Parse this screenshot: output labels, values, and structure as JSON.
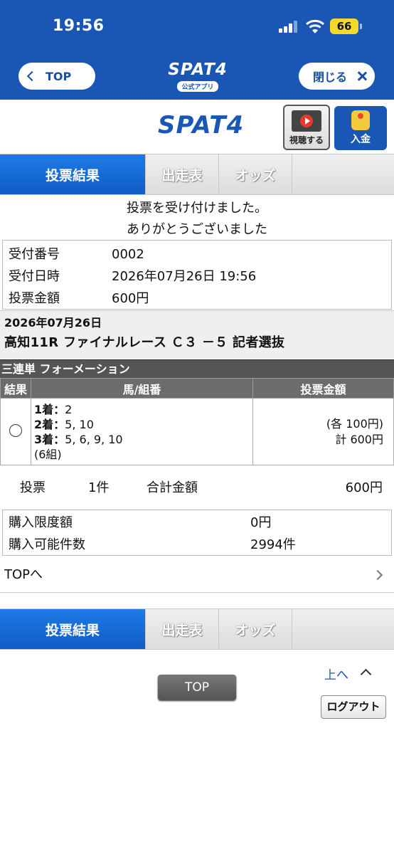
{
  "status_bar": {
    "time": "19:56",
    "battery": "66"
  },
  "app_bar": {
    "back_label": "TOP",
    "logo_text": "SPAT4",
    "logo_sub": "公式アプリ",
    "close_label": "閉じる"
  },
  "header": {
    "logo_text": "SPAT4",
    "watch_label": "視聴する",
    "deposit_label": "入金"
  },
  "tabs": [
    "投票結果",
    "出走表",
    "オッズ",
    ""
  ],
  "confirmation": {
    "line1": "投票を受け付けました。",
    "line2": "ありがとうございました"
  },
  "receipt": {
    "number_label": "受付番号",
    "number_value": "0002",
    "datetime_label": "受付日時",
    "datetime_value": "2026年07月26日 19:56",
    "amount_label": "投票金額",
    "amount_value": "600円"
  },
  "race": {
    "date": "2026年07月26日",
    "name": "高知11R ファイナルレース Ｃ３ －５ 記者選抜"
  },
  "bet_type": "三連単 フォーメーション",
  "table": {
    "headers": [
      "結果",
      "馬/組番",
      "投票金額"
    ],
    "row": {
      "place1_label": "1着",
      "place1_value": "2",
      "place2_label": "2着",
      "place2_value": "5, 10",
      "place3_label": "3着",
      "place3_value": "5, 6, 9, 10",
      "combos": "(6組)",
      "each": "(各 100円)",
      "total": "計 600円"
    }
  },
  "summary": {
    "label": "投票",
    "count": "1件",
    "total_label": "合計金額",
    "total_value": "600円"
  },
  "limits": {
    "limit_label": "購入限度額",
    "limit_value": "0円",
    "possible_label": "購入可能件数",
    "possible_value": "2994件"
  },
  "top_link": "TOPへ",
  "footer": {
    "top_button": "TOP",
    "page_top": "上へ",
    "logout": "ログアウト"
  }
}
